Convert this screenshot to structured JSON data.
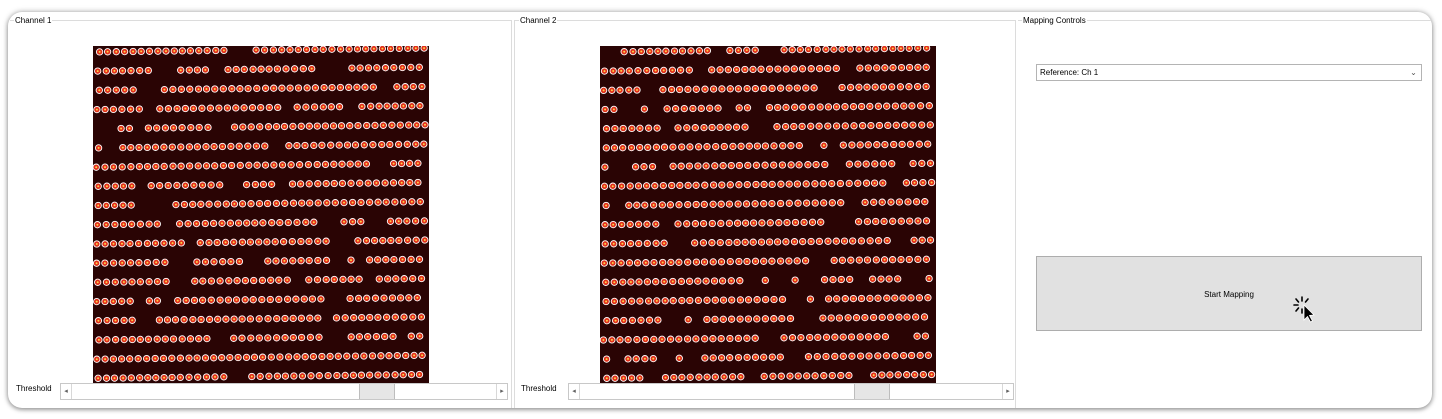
{
  "channel1": {
    "title": "Channel 1",
    "threshold_label": "Threshold",
    "threshold_value": 0.74
  },
  "channel2": {
    "title": "Channel 2",
    "threshold_label": "Threshold",
    "threshold_value": 0.71
  },
  "mapping": {
    "title": "Mapping Controls",
    "reference_selected": "Reference: Ch 1",
    "start_button_label": "Start Mapping"
  },
  "icons": {
    "slider_left": "chevron-left-icon",
    "slider_right": "chevron-right-icon",
    "dropdown": "chevron-down-icon",
    "cursor": "busy-cursor-icon"
  },
  "colors": {
    "image_background": "#2a0404",
    "spot_fill": "#e0301a",
    "spot_ring": "#ffffff",
    "button_face": "#e1e1e1"
  }
}
